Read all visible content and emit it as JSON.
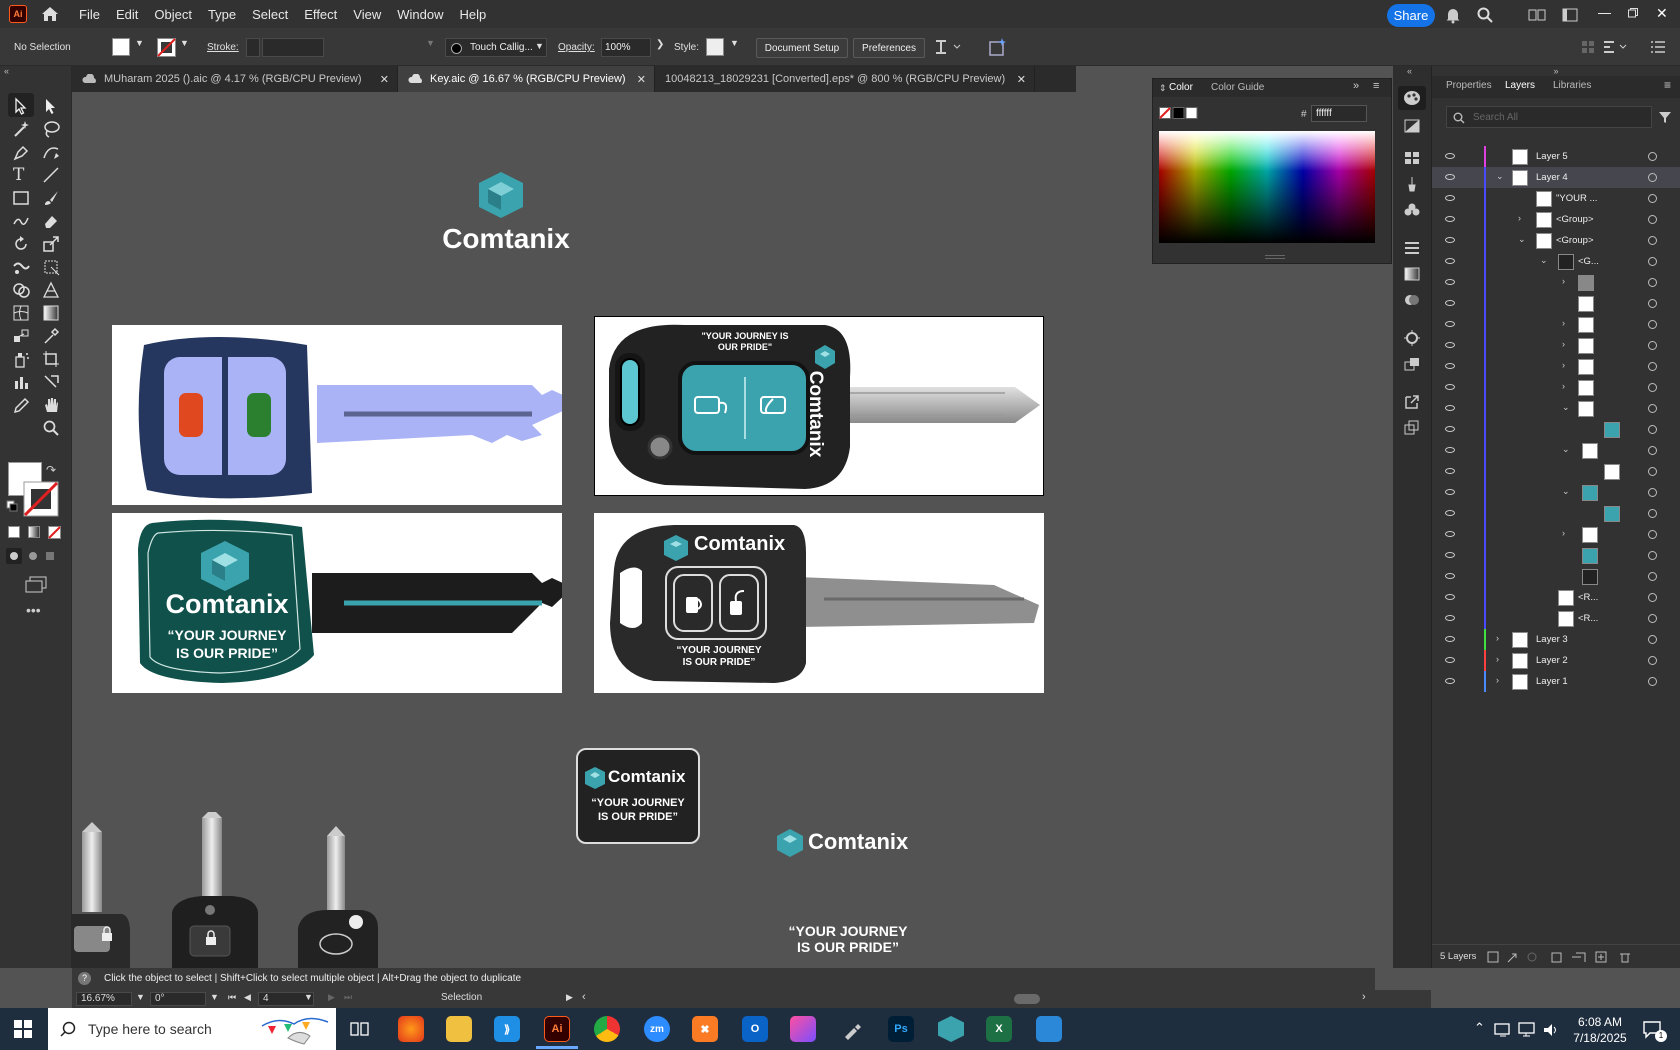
{
  "app": {
    "logo": "Ai",
    "accent": "#ff5a1a"
  },
  "menu": [
    "File",
    "Edit",
    "Object",
    "Type",
    "Select",
    "Effect",
    "View",
    "Window",
    "Help"
  ],
  "header": {
    "share": "Share"
  },
  "control_bar": {
    "selection": "No Selection",
    "stroke_label": "Stroke:",
    "brush": "Touch Callig...",
    "opacity_label": "Opacity:",
    "opacity_value": "100%",
    "style_label": "Style:",
    "document_setup": "Document Setup",
    "preferences": "Preferences"
  },
  "tabs": [
    {
      "label": "MUharam 2025 ().aic @ 4.17 % (RGB/CPU Preview)",
      "active": false
    },
    {
      "label": "Key.aic @ 16.67 % (RGB/CPU Preview)",
      "active": true
    },
    {
      "label": "10048213_18029231 [Converted].eps* @ 800 % (RGB/CPU Preview)",
      "active": false
    }
  ],
  "color_panel": {
    "tab_color": "Color",
    "tab_guide": "Color Guide",
    "hash": "#",
    "hex": "ffffff"
  },
  "right_panel": {
    "tabs": [
      "Properties",
      "Layers",
      "Libraries"
    ],
    "search_placeholder": "Search All",
    "footer": "5 Layers",
    "layers": [
      {
        "name": "Layer 5",
        "color": "#e040e0",
        "indent": 0,
        "caret": ""
      },
      {
        "name": "Layer 4",
        "color": "#4a4aff",
        "indent": 0,
        "caret": "v"
      },
      {
        "name": "\"YOUR ...",
        "color": "#4a4aff",
        "indent": 1,
        "caret": ""
      },
      {
        "name": "<Group>",
        "color": "#4a4aff",
        "indent": 1,
        "caret": ">"
      },
      {
        "name": "<Group>",
        "color": "#4a4aff",
        "indent": 1,
        "caret": "v"
      },
      {
        "name": "<G...",
        "color": "#4a4aff",
        "indent": 2,
        "caret": "v"
      },
      {
        "name": "",
        "color": "#4a4aff",
        "indent": 3,
        "caret": ">"
      },
      {
        "name": "",
        "color": "#4a4aff",
        "indent": 3,
        "caret": ""
      },
      {
        "name": "",
        "color": "#4a4aff",
        "indent": 3,
        "caret": ">"
      },
      {
        "name": "",
        "color": "#4a4aff",
        "indent": 3,
        "caret": ">"
      },
      {
        "name": "",
        "color": "#4a4aff",
        "indent": 3,
        "caret": ">"
      },
      {
        "name": "",
        "color": "#4a4aff",
        "indent": 3,
        "caret": ">"
      },
      {
        "name": "",
        "color": "#4a4aff",
        "indent": 3,
        "caret": "v"
      },
      {
        "name": "",
        "color": "#4a4aff",
        "indent": 4,
        "caret": ""
      },
      {
        "name": "",
        "color": "#4a4aff",
        "indent": 3,
        "caret": "v"
      },
      {
        "name": "",
        "color": "#4a4aff",
        "indent": 4,
        "caret": ""
      },
      {
        "name": "",
        "color": "#4a4aff",
        "indent": 3,
        "caret": "v"
      },
      {
        "name": "",
        "color": "#4a4aff",
        "indent": 4,
        "caret": ""
      },
      {
        "name": "",
        "color": "#4a4aff",
        "indent": 3,
        "caret": ">"
      },
      {
        "name": "",
        "color": "#4a4aff",
        "indent": 3,
        "caret": ""
      },
      {
        "name": "",
        "color": "#4a4aff",
        "indent": 3,
        "caret": ""
      },
      {
        "name": "<R...",
        "color": "#4a4aff",
        "indent": 2,
        "caret": ""
      },
      {
        "name": "<R...",
        "color": "#4a4aff",
        "indent": 2,
        "caret": ""
      },
      {
        "name": "Layer 3",
        "color": "#40e040",
        "indent": 0,
        "caret": ">"
      },
      {
        "name": "Layer 2",
        "color": "#ff4040",
        "indent": 0,
        "caret": ">"
      },
      {
        "name": "Layer 1",
        "color": "#4a8aff",
        "indent": 0,
        "caret": ">"
      }
    ]
  },
  "artwork": {
    "brand": "Comtanix",
    "slogan_line1": "“YOUR JOURNEY",
    "slogan_line2": "IS OUR PRIDE”",
    "slogan2_line1": "\"YOUR JOURNEY IS",
    "slogan2_line2": "OUR PRIDE\"",
    "brand_teal": "#3ba3ad",
    "key_navy": "#25375f",
    "key_periwinkle": "#a9b3f5",
    "key_green": "#11514b"
  },
  "status": {
    "hint": "Click the object to select  |  Shift+Click to select multiple object  |  Alt+Drag the object to duplicate",
    "zoom": "16.67%",
    "rotation": "0°",
    "artboard": "4",
    "tool": "Selection"
  },
  "taskbar": {
    "search_placeholder": "Type here to search",
    "time": "6:08 AM",
    "date": "7/18/2025",
    "notifications": "1"
  }
}
